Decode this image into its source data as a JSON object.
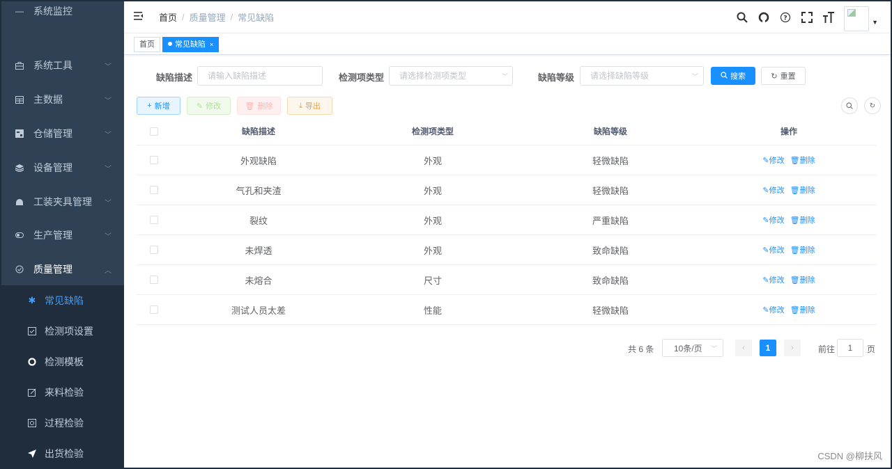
{
  "sidebar": {
    "partial_item": "系统监控",
    "items": [
      {
        "label": "系统工具",
        "icon": "toolbox-icon"
      },
      {
        "label": "主数据",
        "icon": "table-icon"
      },
      {
        "label": "仓储管理",
        "icon": "warehouse-icon"
      },
      {
        "label": "设备管理",
        "icon": "layers-icon"
      },
      {
        "label": "工装夹具管理",
        "icon": "fixture-icon"
      },
      {
        "label": "生产管理",
        "icon": "production-icon"
      },
      {
        "label": "质量管理",
        "icon": "quality-icon"
      }
    ],
    "sub_items": [
      {
        "label": "常见缺陷",
        "icon": "bug-icon",
        "active": true
      },
      {
        "label": "检测项设置",
        "icon": "checkbox-icon"
      },
      {
        "label": "检测模板",
        "icon": "template-icon"
      },
      {
        "label": "来料检验",
        "icon": "edit-icon"
      },
      {
        "label": "过程检验",
        "icon": "process-icon"
      },
      {
        "label": "出货检验",
        "icon": "send-icon"
      }
    ],
    "colors": {
      "bg": "#304156",
      "sub_bg": "#1f2d3d",
      "active": "#409eff"
    }
  },
  "navbar": {
    "breadcrumb": [
      "首页",
      "质量管理",
      "常见缺陷"
    ],
    "icons": [
      "search-icon",
      "github-icon",
      "question-icon",
      "fullscreen-icon",
      "font-size-icon"
    ]
  },
  "tags": {
    "home": "首页",
    "active": "常见缺陷",
    "close": "×"
  },
  "search": {
    "desc_label": "缺陷描述",
    "desc_placeholder": "请输入缺陷描述",
    "type_label": "检测项类型",
    "type_placeholder": "请选择检测项类型",
    "level_label": "缺陷等级",
    "level_placeholder": "请选择缺陷等级",
    "search_button": "搜索",
    "reset_button": "重置"
  },
  "toolbar": {
    "add": "新增",
    "edit": "修改",
    "delete": "删除",
    "export": "导出"
  },
  "table": {
    "columns": [
      "缺陷描述",
      "检测项类型",
      "缺陷等级",
      "操作"
    ],
    "rows": [
      {
        "desc": "外观缺陷",
        "type": "外观",
        "level": "轻微缺陷"
      },
      {
        "desc": "气孔和夹渣",
        "type": "外观",
        "level": "轻微缺陷"
      },
      {
        "desc": "裂纹",
        "type": "外观",
        "level": "严重缺陷"
      },
      {
        "desc": "未焊透",
        "type": "外观",
        "level": "致命缺陷"
      },
      {
        "desc": "未熔合",
        "type": "尺寸",
        "level": "致命缺陷"
      },
      {
        "desc": "测试人员太差",
        "type": "性能",
        "level": "轻微缺陷"
      }
    ],
    "op_edit": "修改",
    "op_delete": "删除"
  },
  "pagination": {
    "total": "共 6 条",
    "page_size": "10条/页",
    "current": "1",
    "goto_prefix": "前往",
    "goto_value": "1",
    "goto_suffix": "页"
  },
  "watermark": "CSDN @柳扶风"
}
